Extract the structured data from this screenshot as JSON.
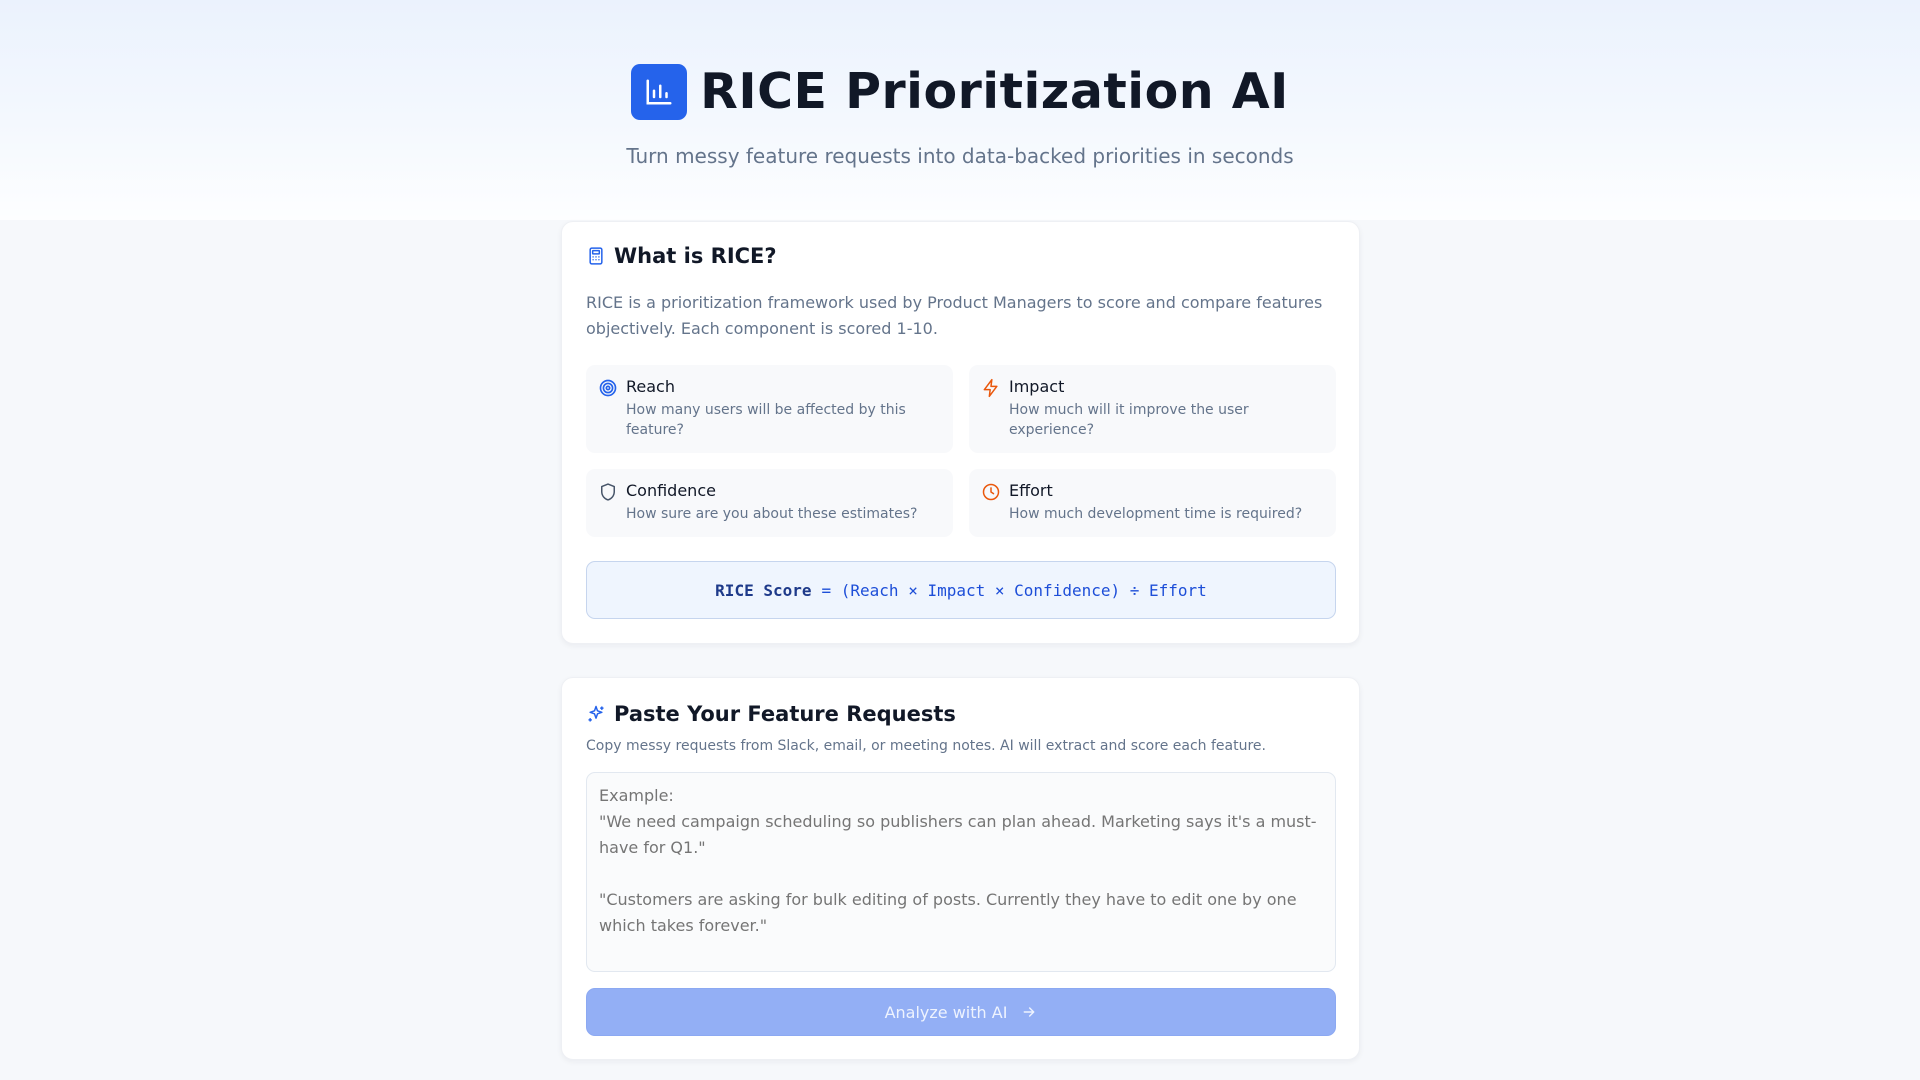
{
  "header": {
    "title": "RICE Prioritization AI",
    "subtitle": "Turn messy feature requests into data-backed priorities in seconds",
    "logo_icon": "bar-chart-icon",
    "brand_color": "#2563eb"
  },
  "rice_info": {
    "title": "What is RICE?",
    "icon": "calculator-icon",
    "description": "RICE is a prioritization framework used by Product Managers to score and compare features objectively. Each component is scored 1-10.",
    "components": [
      {
        "name": "Reach",
        "description": "How many users will be affected by this feature?",
        "icon": "target-icon",
        "color": "#2563eb"
      },
      {
        "name": "Impact",
        "description": "How much will it improve the user experience?",
        "icon": "lightning-icon",
        "color": "#ea580c"
      },
      {
        "name": "Confidence",
        "description": "How sure are you about these estimates?",
        "icon": "shield-icon",
        "color": "#475569"
      },
      {
        "name": "Effort",
        "description": "How much development time is required?",
        "icon": "clock-icon",
        "color": "#ea580c"
      }
    ],
    "formula_label": "RICE Score",
    "formula_expression": "= (Reach × Impact × Confidence) ÷ Effort"
  },
  "input_section": {
    "title": "Paste Your Feature Requests",
    "icon": "sparkles-icon",
    "description": "Copy messy requests from Slack, email, or meeting notes. AI will extract and score each feature.",
    "placeholder": "Example:\n\"We need campaign scheduling so publishers can plan ahead. Marketing says it's a must-have for Q1.\"\n\n\"Customers are asking for bulk editing of posts. Currently they have to edit one by one which takes forever.\"\n\n\"The mobile app crashes when uploading large images. Support ticket volume about this",
    "value": "",
    "button_label": "Analyze with AI",
    "button_icon": "arrow-right-icon"
  }
}
